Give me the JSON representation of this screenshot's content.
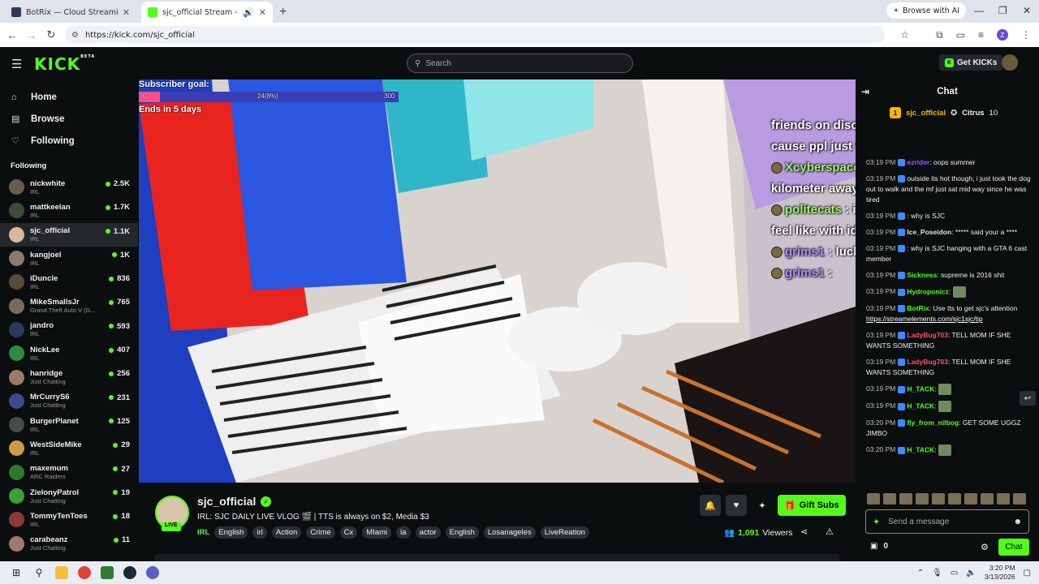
{
  "browser": {
    "tabs": [
      {
        "title": "BotRix — Cloud Streaming Bot",
        "favicon_color": "#2d3b55"
      },
      {
        "title": "sjc_official Stream - Watch Live",
        "favicon_color": "#53fc18"
      }
    ],
    "url": "https://kick.com/sjc_official",
    "browse_ai_label": "Browse with AI",
    "profile_letter": "Z"
  },
  "header": {
    "logo": "KICK",
    "beta": "BETA",
    "search_placeholder": "Search",
    "get_kicks": "Get KICKs"
  },
  "sidebar": {
    "nav": [
      {
        "label": "Home",
        "icon": "home-icon"
      },
      {
        "label": "Browse",
        "icon": "browse-icon"
      },
      {
        "label": "Following",
        "icon": "heart-icon"
      }
    ],
    "following_heading": "Following",
    "channels": [
      {
        "name": "nickwhite",
        "category": "IRL",
        "viewers": "2.5K",
        "color": "#6b5b4b"
      },
      {
        "name": "mattkeelan",
        "category": "IRL",
        "viewers": "1.7K",
        "color": "#3c4a3a"
      },
      {
        "name": "sjc_official",
        "category": "IRL",
        "viewers": "1.1K",
        "color": "#d8b89a"
      },
      {
        "name": "kangjoel",
        "category": "IRL",
        "viewers": "1K",
        "color": "#8a7a6a"
      },
      {
        "name": "iDuncle",
        "category": "IRL",
        "viewers": "836",
        "color": "#5a4a3a"
      },
      {
        "name": "MikeSmallsJr",
        "category": "Grand Theft Auto V (G...",
        "viewers": "765",
        "color": "#7a6a5a"
      },
      {
        "name": "jandro",
        "category": "IRL",
        "viewers": "593",
        "color": "#2a3a5a"
      },
      {
        "name": "NickLee",
        "category": "IRL",
        "viewers": "407",
        "color": "#2e8b3e"
      },
      {
        "name": "hanridge",
        "category": "Just Chatting",
        "viewers": "256",
        "color": "#9a7a6a"
      },
      {
        "name": "MrCurryS6",
        "category": "Just Chatting",
        "viewers": "231",
        "color": "#3a4a8a"
      },
      {
        "name": "BurgerPlanet",
        "category": "IRL",
        "viewers": "125",
        "color": "#4a4a4a"
      },
      {
        "name": "WestSideMike",
        "category": "IRL",
        "viewers": "29",
        "color": "#c8a040"
      },
      {
        "name": "maxemum",
        "category": "ARC Raiders",
        "viewers": "27",
        "color": "#2a7a2a"
      },
      {
        "name": "ZielonyPatrol",
        "category": "Just Chatting",
        "viewers": "19",
        "color": "#3aa03a"
      },
      {
        "name": "TommyTenToes",
        "category": "IRL",
        "viewers": "18",
        "color": "#8a3a3a"
      },
      {
        "name": "carabeanz",
        "category": "Just Chatting",
        "viewers": "11",
        "color": "#a07a6a"
      }
    ]
  },
  "video": {
    "subscriber_goal_label": "Subscriber goal:",
    "goal_start": "0",
    "goal_current": "24(8%)",
    "goal_end": "300",
    "goal_progress": 0.08,
    "goal_ends": "Ends in 5 days",
    "overlay_messages": [
      {
        "user": "",
        "text": "friends on discord but i end up turning it off cause ppl just fucking annoy me"
      },
      {
        "user": "XcyberspaceX",
        "text": " : I can spot a weirdo a kilometer away im like robocop"
      },
      {
        "user": "politecats",
        "text": " : it's like having an extra phone i feel like with idiots texting you"
      },
      {
        "user": "grims1",
        "text": " : luckily never experienced that"
      },
      {
        "user": "grims1",
        "text": " :"
      }
    ]
  },
  "stream": {
    "streamer": "sjc_official",
    "live_label": "LIVE",
    "title": "IRL: SJC DAILY LIVE VLOG 🎬 | TTS is always on $2, Media $3",
    "category": "IRL",
    "tags": [
      "English",
      "irl",
      "Action",
      "Crime",
      "Cx",
      "MIami",
      "la",
      "actor",
      "English",
      "Losanageles",
      "LiveReation"
    ],
    "viewers_count": "1,091",
    "viewers_label": "Viewers",
    "gift_subs": "Gift Subs"
  },
  "chat": {
    "title": "Chat",
    "pinned_user": "sjc_official",
    "pinned_badge": "1",
    "pinned_extra": "Citrus",
    "pinned_count": "10",
    "messages": [
      {
        "time": "03:19 PM",
        "user": "ezrider",
        "color": "#9b59ff",
        "text": ": oops summer"
      },
      {
        "time": "03:19 PM",
        "user": "",
        "color": "#ff4444",
        "text": "outside its hot though, i just took the dog out to walk and the mf just sat mid way since he was tired"
      },
      {
        "time": "03:19 PM",
        "user": "",
        "color": "#e0e0e0",
        "text": ": why is SJC"
      },
      {
        "time": "03:19 PM",
        "user": "Ice_Poseidon",
        "color": "#e0e0e0",
        "text": ": ***** said your a ****"
      },
      {
        "time": "03:19 PM",
        "user": "",
        "color": "#e0e0e0",
        "text": ": why is SJC hanging with a GTA 6 cast member"
      },
      {
        "time": "03:19 PM",
        "user": "Sickness",
        "color": "#53fc18",
        "text": ": supreme is 2016 shit"
      },
      {
        "time": "03:19 PM",
        "user": "Hydroponicz",
        "color": "#53fc18",
        "text": ":"
      },
      {
        "time": "03:19 PM",
        "user": "BotRix",
        "color": "#53fc18",
        "text": ": Use tts to get sjc's attention",
        "link": "https://streamelements.com/sjc1sjc/tip"
      },
      {
        "time": "03:19 PM",
        "user": "LadyBug703",
        "color": "#ff4f6b",
        "text": ": TELL MOM IF SHE WANTS SOMETHING"
      },
      {
        "time": "03:19 PM",
        "user": "LadyBug703",
        "color": "#ff4f6b",
        "text": ": TELL MOM IF SHE WANTS SOMETHING"
      },
      {
        "time": "03:19 PM",
        "user": "H_TACK",
        "color": "#53fc18",
        "text": ":"
      },
      {
        "time": "03:19 PM",
        "user": "H_TACK",
        "color": "#53fc18",
        "text": ":"
      },
      {
        "time": "03:20 PM",
        "user": "fly_from_nilbog",
        "color": "#53fc18",
        "text": ": GET SOME UGGZ JIMBO"
      },
      {
        "time": "03:20 PM",
        "user": "H_TACK",
        "color": "#53fc18",
        "text": ":"
      }
    ],
    "send_placeholder": "Send a message",
    "points": "0",
    "chat_button": "Chat"
  },
  "taskbar": {
    "time": "3:20 PM",
    "date": "3/13/2026"
  }
}
